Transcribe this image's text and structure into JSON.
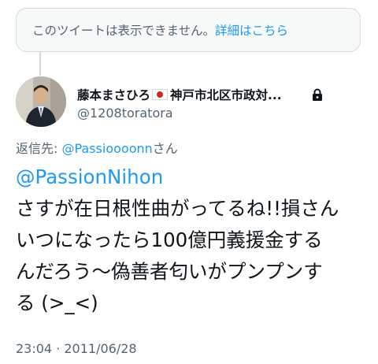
{
  "notice": {
    "text": "このツイートは表示できません。",
    "link": "詳細はこちら"
  },
  "author": {
    "name_prefix": "藤本まさひろ",
    "name_suffix": "神戸市北区市政対...",
    "handle": "@1208toratora",
    "flag_icon": "japan-flag",
    "lock_icon": "lock-icon"
  },
  "reply": {
    "label": "返信先: ",
    "mention": "@Passioooonn",
    "suffix": "さん"
  },
  "tweet": {
    "mention": "@PassionNihon",
    "lines": [
      "さすが在日根性曲がってるね!!損さん",
      "いつになったら100億円義援金する",
      "んだろう〜偽善者匂いがプンプンす",
      "る (>_<)"
    ]
  },
  "meta": {
    "time": "23:04 · 2011/06/28"
  }
}
